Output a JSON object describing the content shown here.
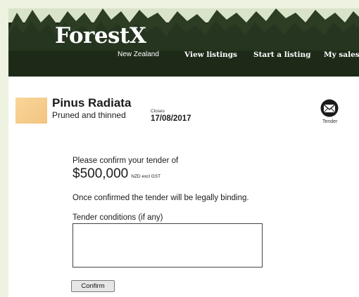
{
  "header": {
    "logo": "ForestX",
    "logo_sub": "New Zealand",
    "nav": [
      {
        "label": "View listings"
      },
      {
        "label": "Start a listing"
      },
      {
        "label": "My sales"
      }
    ]
  },
  "listing": {
    "title": "Pinus Radiata",
    "subtitle": "Pruned and thinned",
    "closes_label": "Closes",
    "closes_date": "17/08/2017",
    "tender_icon": "envelope-icon",
    "tender_label": "Tender"
  },
  "form": {
    "confirm_prompt": "Please confirm your tender of",
    "amount": "$500,000",
    "amount_note": "NZD excl GST",
    "binding_notice": "Once confirmed the tender will be legally binding.",
    "conditions_label": "Tender conditions (if any)",
    "conditions_value": "",
    "confirm_button": "Confirm"
  },
  "colors": {
    "page_bg": "#eef2e0",
    "header_dark": "#1d2a18",
    "sky": "#d8e3c8",
    "thumb": "#f5cd8c",
    "text": "#1b1b1b"
  }
}
